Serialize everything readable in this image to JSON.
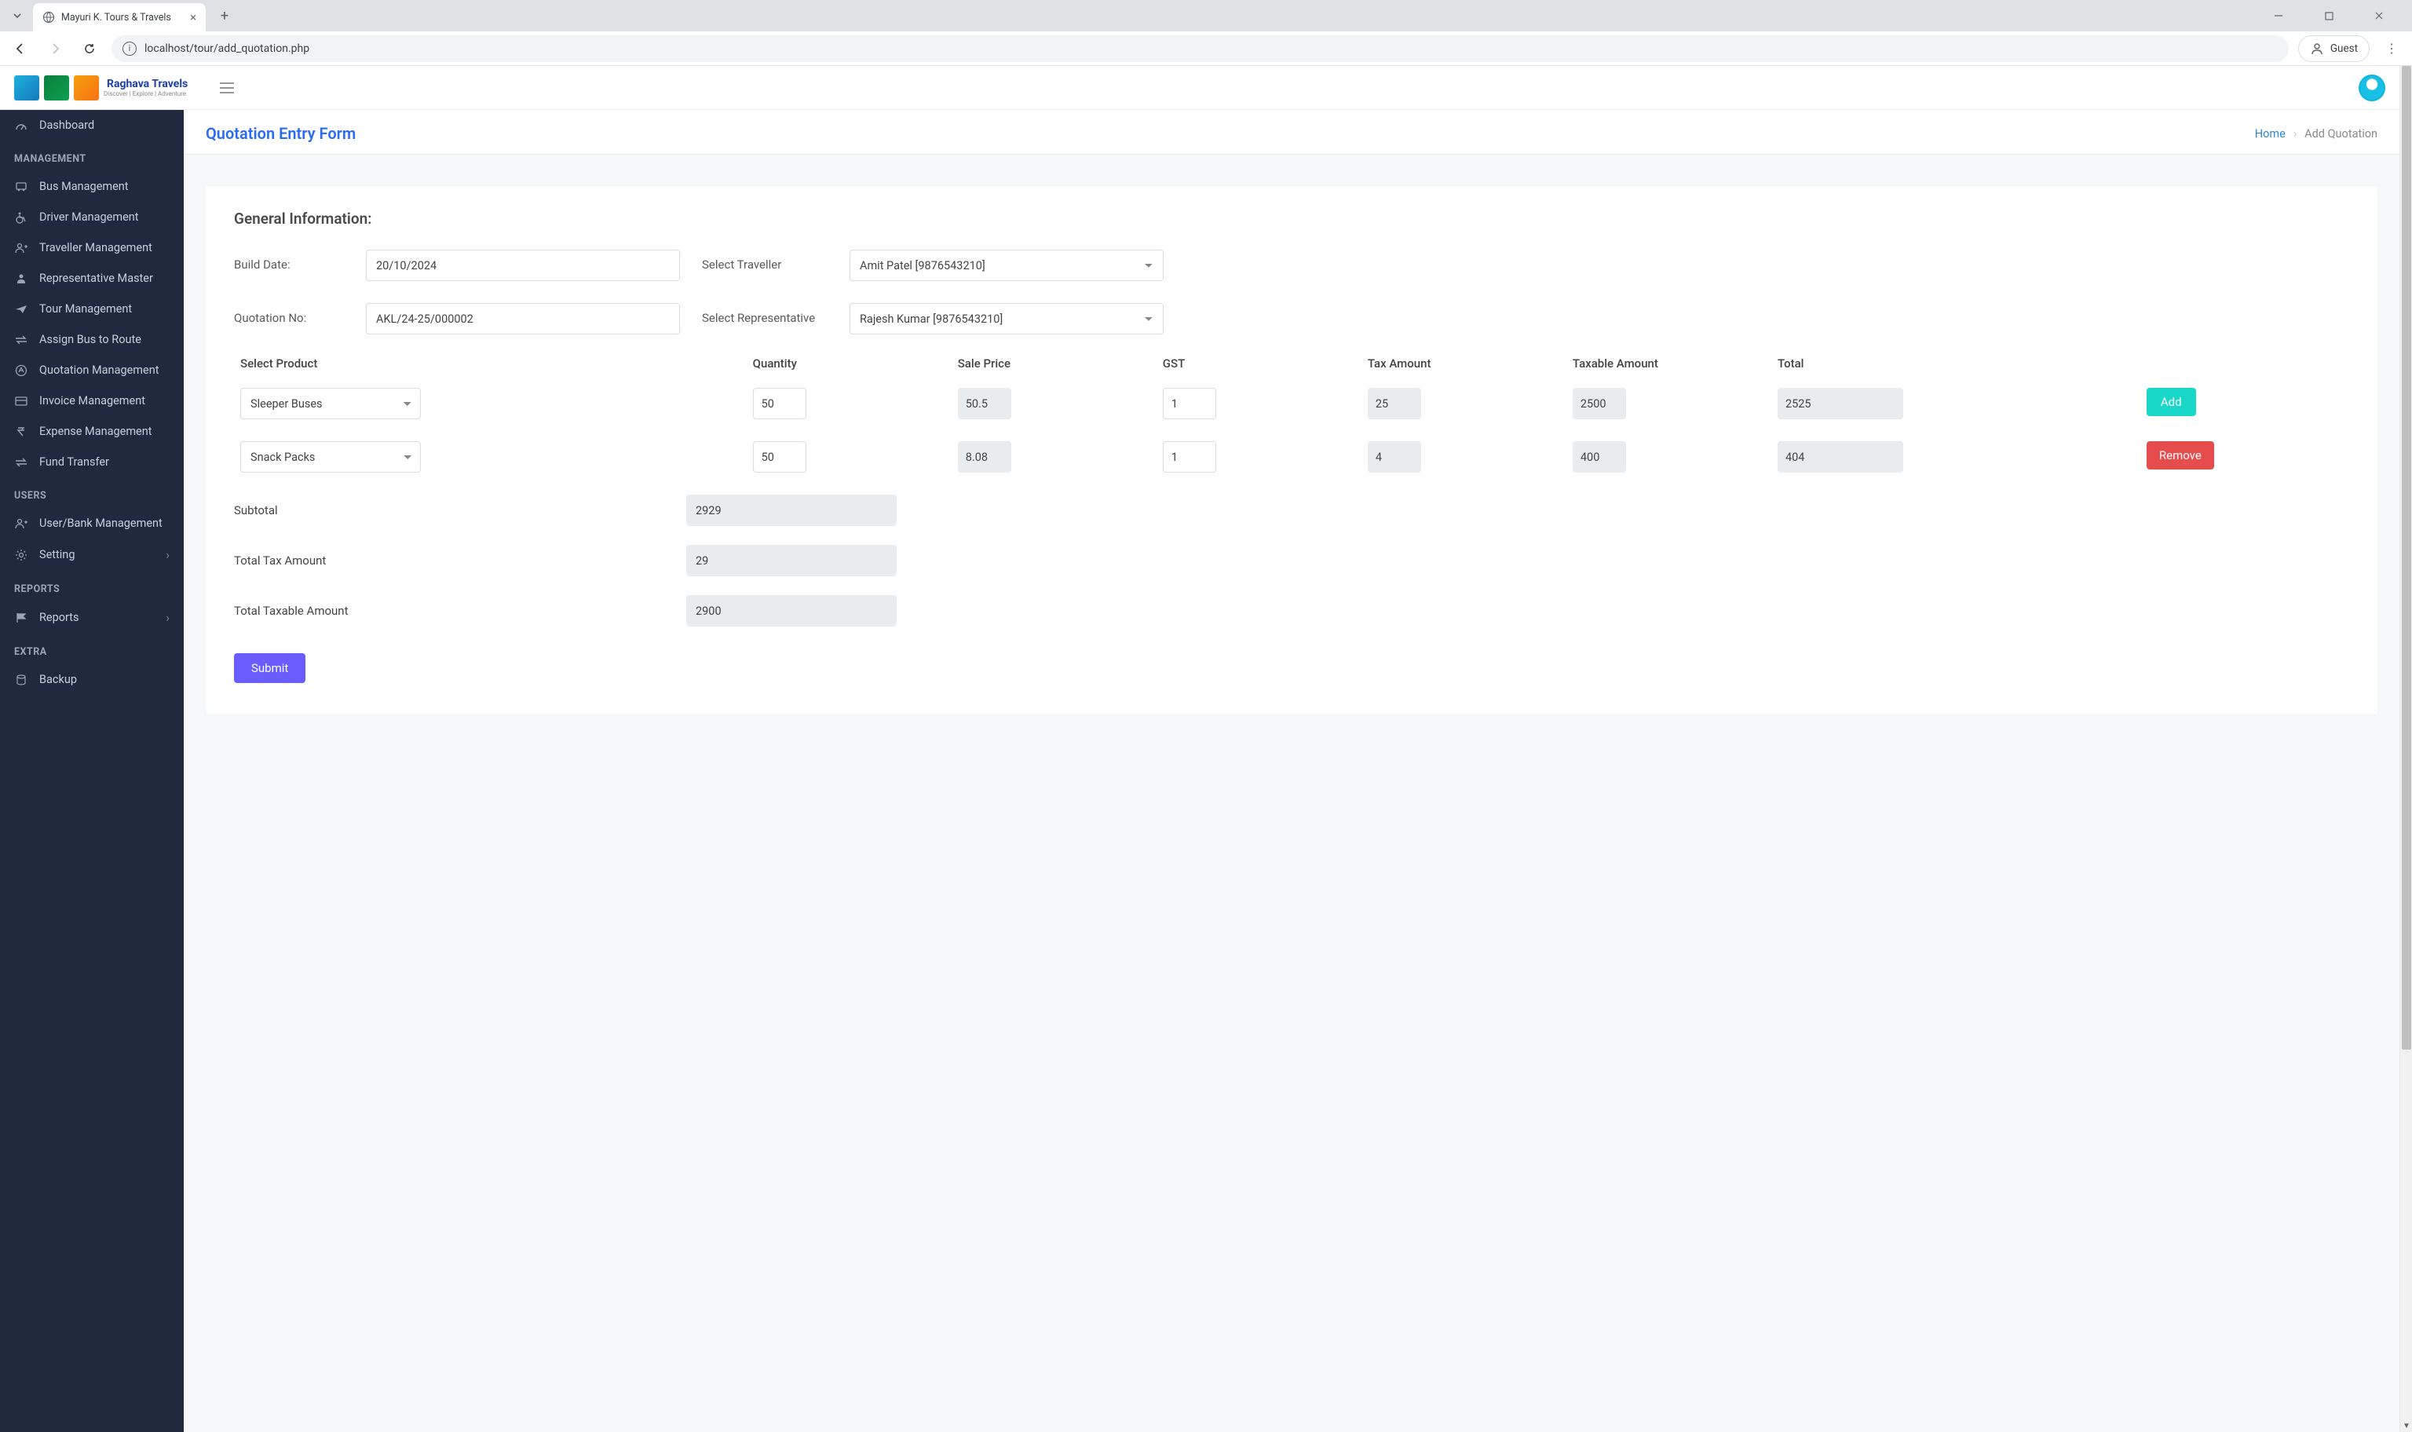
{
  "browser": {
    "tab_title": "Mayuri K. Tours & Travels",
    "url": "localhost/tour/add_quotation.php",
    "guest_label": "Guest"
  },
  "brand": {
    "name": "Raghava Travels",
    "tagline": "Discover | Explore | Adventure"
  },
  "sidebar": {
    "dashboard": "Dashboard",
    "sections": {
      "management": "MANAGEMENT",
      "users": "USERS",
      "reports": "REPORTS",
      "extra": "EXTRA"
    },
    "items": {
      "bus": "Bus Management",
      "driver": "Driver Management",
      "traveller": "Traveller Management",
      "rep_master": "Representative Master",
      "tour": "Tour Management",
      "assign_bus": "Assign Bus to Route",
      "quotation": "Quotation Management",
      "invoice": "Invoice Management",
      "expense": "Expense Management",
      "fund": "Fund Transfer",
      "userbank": "User/Bank Management",
      "setting": "Setting",
      "reports": "Reports",
      "backup": "Backup"
    }
  },
  "page": {
    "title": "Quotation Entry Form",
    "breadcrumb_home": "Home",
    "breadcrumb_current": "Add Quotation",
    "section_title": "General Information:"
  },
  "form": {
    "labels": {
      "build_date": "Build Date:",
      "quotation_no": "Quotation No:",
      "select_traveller": "Select Traveller",
      "select_rep": "Select Representative"
    },
    "values": {
      "build_date": "20/10/2024",
      "quotation_no": "AKL/24-25/000002",
      "traveller": "Amit Patel [9876543210]",
      "representative": "Rajesh Kumar [9876543210]"
    }
  },
  "table": {
    "headers": {
      "product": "Select Product",
      "qty": "Quantity",
      "sale": "Sale Price",
      "gst": "GST",
      "tax_amt": "Tax Amount",
      "taxable_amt": "Taxable Amount",
      "total": "Total"
    },
    "rows": [
      {
        "product": "Sleeper Buses",
        "qty": "50",
        "sale": "50.5",
        "gst": "1",
        "tax": "25",
        "taxable": "2500",
        "total": "2525",
        "action": "Add"
      },
      {
        "product": "Snack Packs",
        "qty": "50",
        "sale": "8.08",
        "gst": "1",
        "tax": "4",
        "taxable": "400",
        "total": "404",
        "action": "Remove"
      }
    ]
  },
  "totals": {
    "subtotal_label": "Subtotal",
    "subtotal": "2929",
    "tax_label": "Total Tax Amount",
    "tax": "29",
    "taxable_label": "Total Taxable Amount",
    "taxable": "2900"
  },
  "buttons": {
    "submit": "Submit"
  }
}
